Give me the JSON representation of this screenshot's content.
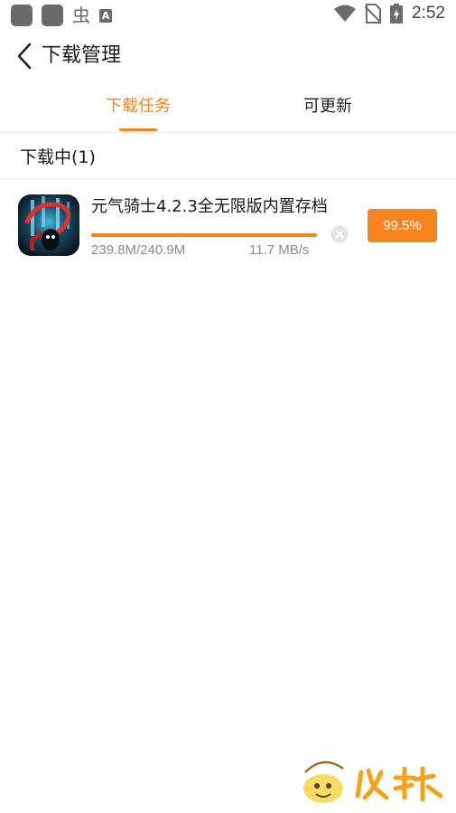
{
  "status_bar": {
    "time": "2:52",
    "left_icons": [
      "app-notification-icon",
      "app-notification-icon",
      "bug-icon",
      "font-icon"
    ],
    "right_icons": [
      "wifi-icon",
      "no-sim-icon",
      "battery-charging-icon"
    ],
    "bug_glyph": "虫",
    "font_glyph": "A"
  },
  "header": {
    "back_icon": "chevron-left-icon",
    "title": "下载管理"
  },
  "tabs": [
    {
      "label": "下载任务",
      "active": true
    },
    {
      "label": "可更新",
      "active": false
    }
  ],
  "section": {
    "title": "下载中(1)"
  },
  "downloads": [
    {
      "name": "元气骑士4.2.3全无限版内置存档",
      "icon": "soul-knight-app-icon",
      "size": "239.8M/240.9M",
      "speed": "11.7 MB/s",
      "progress_percent": 99.5,
      "progress_label": "99.5%",
      "cancel_icon": "close-circle-icon"
    }
  ],
  "colors": {
    "accent": "#f5841f",
    "text_primary": "#1a1a1a",
    "text_secondary": "#8a8a8a",
    "divider": "#eeeeee"
  },
  "watermark_icon": "brand-logo-watermark"
}
